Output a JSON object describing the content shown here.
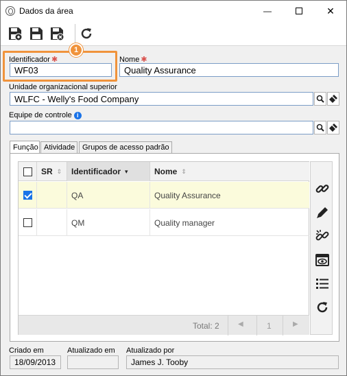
{
  "window": {
    "title": "Dados da área",
    "minimize": "—",
    "maximize": "☐",
    "close": "✕"
  },
  "toolbar": {
    "buttons": [
      "save-new-icon",
      "save-icon",
      "save-close-icon",
      "refresh-icon"
    ]
  },
  "form": {
    "identificador_label": "Identificador",
    "identificador_value": "WF03",
    "nome_label": "Nome",
    "nome_value": "Quality Assurance",
    "unidade_label": "Unidade organizacional superior",
    "unidade_value": "WLFC - Welly's Food Company",
    "equipe_label": "Equipe de controle",
    "equipe_value": "",
    "required_mark": "✱",
    "callout_number": "1"
  },
  "tabs": [
    "Função",
    "Atividade",
    "Grupos de acesso padrão"
  ],
  "grid": {
    "columns": [
      "SR",
      "Identificador",
      "Nome"
    ],
    "rows": [
      {
        "checked": true,
        "sr": "",
        "identificador": "QA",
        "nome": "Quality Assurance"
      },
      {
        "checked": false,
        "sr": "",
        "identificador": "QM",
        "nome": "Quality manager"
      }
    ],
    "total": "Total: 2",
    "page": "1",
    "side_buttons": [
      "link-icon",
      "edit-icon",
      "unlink-icon",
      "view-icon",
      "list-icon",
      "refresh-icon"
    ]
  },
  "footer": {
    "criado_label": "Criado em",
    "criado_value": "18/09/2013",
    "atualizado_label": "Atualizado em",
    "atualizado_value": "",
    "atualizado_por_label": "Atualizado por",
    "atualizado_por_value": "James J. Tooby"
  }
}
